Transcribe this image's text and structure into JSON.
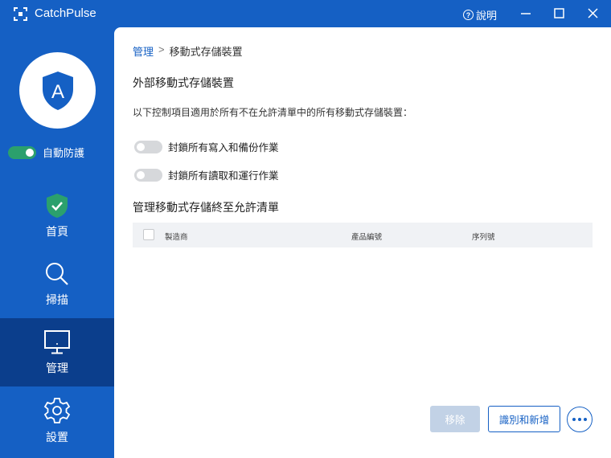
{
  "app": {
    "title": "CatchPulse"
  },
  "titlebar": {
    "help_label": "說明",
    "help_icon": "?"
  },
  "sidebar": {
    "avatar_letter": "A",
    "auto_protect_label": "自動防護",
    "auto_protect_on": true,
    "items": [
      {
        "label": "首頁",
        "icon": "shield-check-icon"
      },
      {
        "label": "掃描",
        "icon": "search-icon"
      },
      {
        "label": "管理",
        "icon": "monitor-icon",
        "active": true
      },
      {
        "label": "設置",
        "icon": "gear-icon"
      }
    ]
  },
  "breadcrumb": {
    "parent": "管理",
    "separator": ">",
    "current": "移動式存儲裝置"
  },
  "main": {
    "section1_title": "外部移動式存儲裝置",
    "description": "以下控制項目適用於所有不在允許清單中的所有移動式存儲裝置：",
    "options": [
      {
        "label": "封鎖所有寫入和備份作業",
        "enabled": false
      },
      {
        "label": "封鎖所有讀取和運行作業",
        "enabled": false
      }
    ],
    "section2_title": "管理移動式存儲終至允許清單",
    "table": {
      "columns": [
        "製造商",
        "產品編號",
        "序列號"
      ],
      "rows": []
    },
    "buttons": {
      "remove": "移除",
      "add": "識別和新增"
    }
  },
  "colors": {
    "brand": "#1560c4",
    "active_nav": "#0b3e8c",
    "toggle_on": "#2ba06d",
    "shield_green": "#2ba06d"
  }
}
